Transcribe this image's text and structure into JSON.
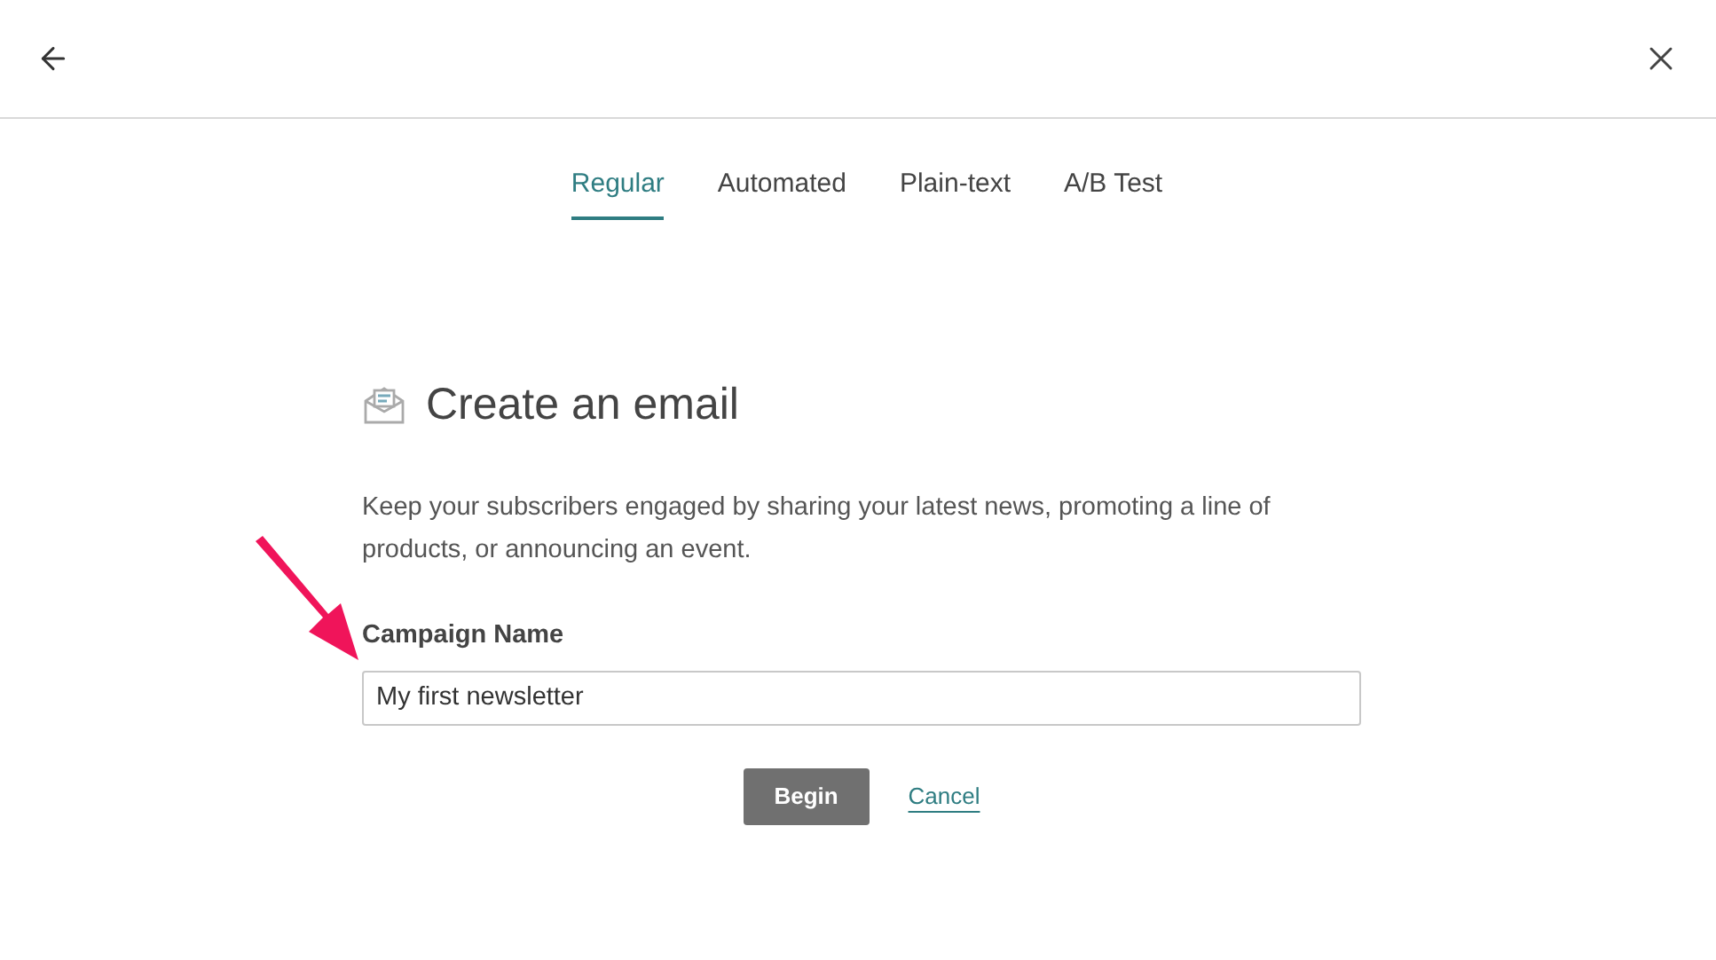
{
  "tabs": [
    {
      "label": "Regular",
      "selected": true
    },
    {
      "label": "Automated",
      "selected": false
    },
    {
      "label": "Plain-text",
      "selected": false
    },
    {
      "label": "A/B Test",
      "selected": false
    }
  ],
  "title": "Create an email",
  "description": "Keep your subscribers engaged by sharing your latest news, promoting a line of products, or announcing an event.",
  "campaign_name": {
    "label": "Campaign Name",
    "value": "My first newsletter"
  },
  "buttons": {
    "primary": "Begin",
    "secondary": "Cancel"
  }
}
